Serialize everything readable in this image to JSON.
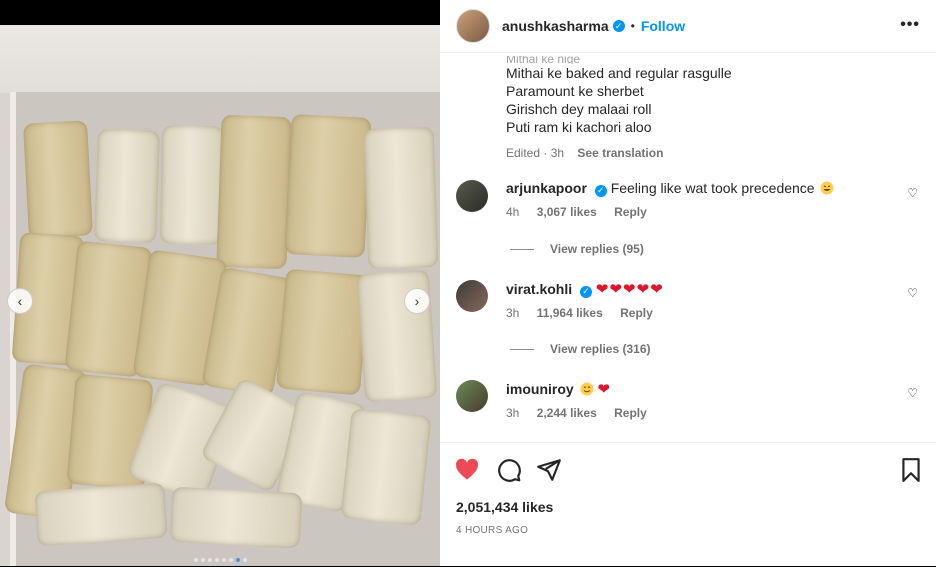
{
  "post": {
    "username": "anushkasharma",
    "follow_label": "Follow",
    "more_label": "•••",
    "caption_cut": "Mithai ke nige",
    "caption_lines": [
      "Mithai ke baked and regular rasgulle",
      "Paramount ke sherbet",
      "Girishch dey malaai roll",
      "Puti ram ki kachori aloo"
    ],
    "caption_time": "Edited · 3h",
    "see_translation": "See translation",
    "likes": "2,051,434 likes",
    "posted_ago": "4 HOURS AGO"
  },
  "comments": [
    {
      "user": "arjunkapoor",
      "text": "Feeling like wat took precedence",
      "time": "4h",
      "likes": "3,067 likes",
      "reply": "Reply",
      "view_replies": "View replies (95)"
    },
    {
      "user": "virat.kohli",
      "text": "",
      "time": "3h",
      "likes": "11,964 likes",
      "reply": "Reply",
      "view_replies": "View replies (316)"
    },
    {
      "user": "imouniroy",
      "text": "",
      "time": "3h",
      "likes": "2,244 likes",
      "reply": "Reply"
    }
  ],
  "colors": {
    "accent": "#0095f6",
    "like": "#ed4956",
    "text": "#262626",
    "muted": "#737373"
  },
  "carousel": {
    "slide_count": 8,
    "active_index": 6
  },
  "icons": [
    "verified-icon",
    "more-icon",
    "heart-icon",
    "comment-icon",
    "share-icon",
    "bookmark-icon",
    "chevron-left-icon",
    "chevron-right-icon",
    "red-heart-emoji",
    "grin-emoji",
    "smile-emoji"
  ]
}
